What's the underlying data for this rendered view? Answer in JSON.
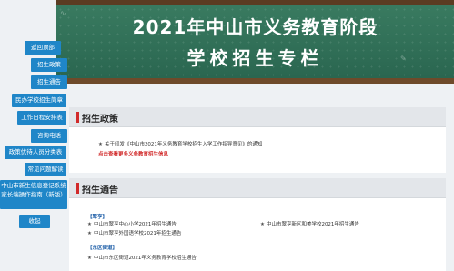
{
  "banner": {
    "line1": "2021年中山市义务教育阶段",
    "line2": "学校招生专栏"
  },
  "sidebar": [
    {
      "label": "返回顶部"
    },
    {
      "label": "招生政策"
    },
    {
      "label": "招生通告"
    },
    {
      "label": "民办学校招生简章"
    },
    {
      "label": "工作日程安排表"
    },
    {
      "label": "咨询电话"
    },
    {
      "label": "政策优待人员分类表"
    },
    {
      "label": "常见问题解读"
    },
    {
      "label": "中山市新生信息登记系统家长端操作指南（新版）"
    },
    {
      "label": "收起"
    }
  ],
  "policy": {
    "title": "招生政策",
    "item": "关于印发《中山市2021年义务教育学校招生入学工作指导意见》的通知",
    "more": "点击查看更多义务教育招生信息"
  },
  "notice": {
    "title": "招生通告",
    "group1": "【翠亨】",
    "items1": [
      "中山市翠亨中心小学2021年招生通告",
      "中山市翠亨新区和美学校2021年招生通告",
      "中山市翠亨外国语学校2021年招生通告"
    ],
    "group2": "【东区街道】",
    "items2": [
      "中山市东区街道2021年义务教育学校招生通告"
    ]
  }
}
